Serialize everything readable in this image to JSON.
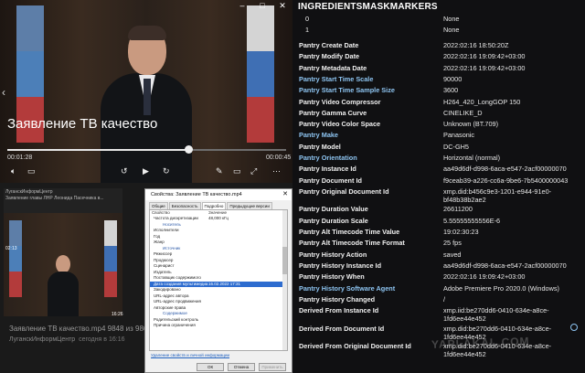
{
  "player": {
    "title": "Заявление ТВ качество",
    "elapsed": "00:01:28",
    "remaining": "00:00:45",
    "progress_fraction": 0.65
  },
  "post": {
    "channel_header": "ЛуганскИнформЦентр",
    "caption": "Заявление главы ЛНР Леонида Пасечника в...",
    "duration": "02:13",
    "thumb_time": "16:26",
    "filename": "Заявление ТВ качество.mp4 9848 из 9865",
    "channel": "ЛуганскИнформЦентр",
    "channel_time": "сегодня в 16:16"
  },
  "dialog": {
    "title": "Свойства: Заявление ТВ качество.mp4",
    "tabs": [
      "Общие",
      "Безопасность",
      "Подробно",
      "Предыдущие версии"
    ],
    "col_prop": "Свойство",
    "col_val": "Значение",
    "rows": [
      {
        "k": "Частота дискретизации",
        "v": "48,000 кГц",
        "type": "row"
      },
      {
        "k": "Носитель",
        "v": "",
        "type": "sec"
      },
      {
        "k": "Исполнители",
        "v": "",
        "type": "row"
      },
      {
        "k": "Год",
        "v": "",
        "type": "row"
      },
      {
        "k": "Жанр",
        "v": "",
        "type": "row"
      },
      {
        "k": "Источник",
        "v": "",
        "type": "sec"
      },
      {
        "k": "Режиссер",
        "v": "",
        "type": "row"
      },
      {
        "k": "Продюсер",
        "v": "",
        "type": "row"
      },
      {
        "k": "Сценарист",
        "v": "",
        "type": "row"
      },
      {
        "k": "Издатель",
        "v": "",
        "type": "row"
      },
      {
        "k": "Поставщик содержимого",
        "v": "",
        "type": "row"
      },
      {
        "k": "Дата создания мультимедиа",
        "v": "16.02.2022 17:31",
        "type": "sel"
      },
      {
        "k": "Закодировано",
        "v": "",
        "type": "row"
      },
      {
        "k": "URL-адрес автора",
        "v": "",
        "type": "row"
      },
      {
        "k": "URL-адрес продвижения",
        "v": "",
        "type": "row"
      },
      {
        "k": "Авторские права",
        "v": "",
        "type": "row"
      },
      {
        "k": "Содержимое",
        "v": "",
        "type": "sec"
      },
      {
        "k": "Родительский контроль",
        "v": "",
        "type": "row"
      },
      {
        "k": "Причина ограничения",
        "v": "",
        "type": "row"
      }
    ],
    "remove_link": "Удаление свойств и личной информации",
    "ok": "ОК",
    "cancel": "Отмена",
    "apply": "Применить"
  },
  "meta": {
    "header": "INGREDIENTSMASKMARKERS",
    "rows": [
      {
        "k": "0",
        "v": "None",
        "blue": false,
        "idx": true
      },
      {
        "k": "1",
        "v": "None",
        "blue": false,
        "idx": true
      },
      {
        "k": "Pantry Create Date",
        "v": "2022:02:16 18:50:20Z",
        "blue": false
      },
      {
        "k": "Pantry Modify Date",
        "v": "2022:02:16 19:09:42+03:00",
        "blue": false
      },
      {
        "k": "Pantry Metadata Date",
        "v": "2022:02:16 19:09:42+03:00",
        "blue": false
      },
      {
        "k": "Pantry Start Time Scale",
        "v": "90000",
        "blue": true
      },
      {
        "k": "Pantry Start Time Sample Size",
        "v": "3600",
        "blue": true
      },
      {
        "k": "Pantry Video Compressor",
        "v": "H264_420_LongGOP 150",
        "blue": false
      },
      {
        "k": "Pantry Gamma Curve",
        "v": "CINELIKE_D",
        "blue": false
      },
      {
        "k": "Pantry Video Color Space",
        "v": "Unknown (BT.709)",
        "blue": false
      },
      {
        "k": "Pantry Make",
        "v": "Panasonic",
        "blue": true
      },
      {
        "k": "Pantry Model",
        "v": "DC-GH5",
        "blue": false
      },
      {
        "k": "Pantry Orientation",
        "v": "Horizontal (normal)",
        "blue": true
      },
      {
        "k": "Pantry Instance Id",
        "v": "aa49d6df-d998-6aca-e547-2acf00000070",
        "blue": false
      },
      {
        "k": "Pantry Document Id",
        "v": "f9ceab39-a226-cc6a-9be6-7b5400000043",
        "blue": false
      },
      {
        "k": "Pantry Original Document Id",
        "v": "xmp.did:b456c9e3-1201-e944-91e0-",
        "v2": "bf48b38b2ae2",
        "blue": false
      },
      {
        "k": "Pantry Duration Value",
        "v": "26611200",
        "blue": false
      },
      {
        "k": "Pantry Duration Scale",
        "v": "5.55555555556E-6",
        "blue": false
      },
      {
        "k": "Pantry Alt Timecode Time Value",
        "v": "19:02:30:23",
        "blue": false
      },
      {
        "k": "Pantry Alt Timecode Time Format",
        "v": "25 fps",
        "blue": false
      },
      {
        "k": "Pantry History Action",
        "v": "saved",
        "blue": false
      },
      {
        "k": "Pantry History Instance Id",
        "v": "aa49d6df-d998-6aca-e547-2acf00000070",
        "blue": false
      },
      {
        "k": "Pantry History When",
        "v": "2022:02:16 19:09:42+03:00",
        "blue": false
      },
      {
        "k": "Pantry History Software Agent",
        "v": "Adobe Premiere Pro 2020.0 (Windows)",
        "blue": true
      },
      {
        "k": "Pantry History Changed",
        "v": "/",
        "blue": false
      },
      {
        "k": "Derived From Instance Id",
        "v": "xmp.iid:be270dd6-0410-634e-a8ce-",
        "v2": "1fd6ee44e452",
        "blue": false
      },
      {
        "k": "Derived From Document Id",
        "v": "xmp.did:be270dd6-0410-634e-a8ce-",
        "v2": "1fd6ee44e452",
        "blue": false
      },
      {
        "k": "Derived From Original Document Id",
        "v": "xmp.did:be270dd6-0410-634e-a8ce-",
        "v2": "1fd6ee44e452",
        "blue": false
      }
    ],
    "watermark": "YAPLAKAL.COM"
  }
}
